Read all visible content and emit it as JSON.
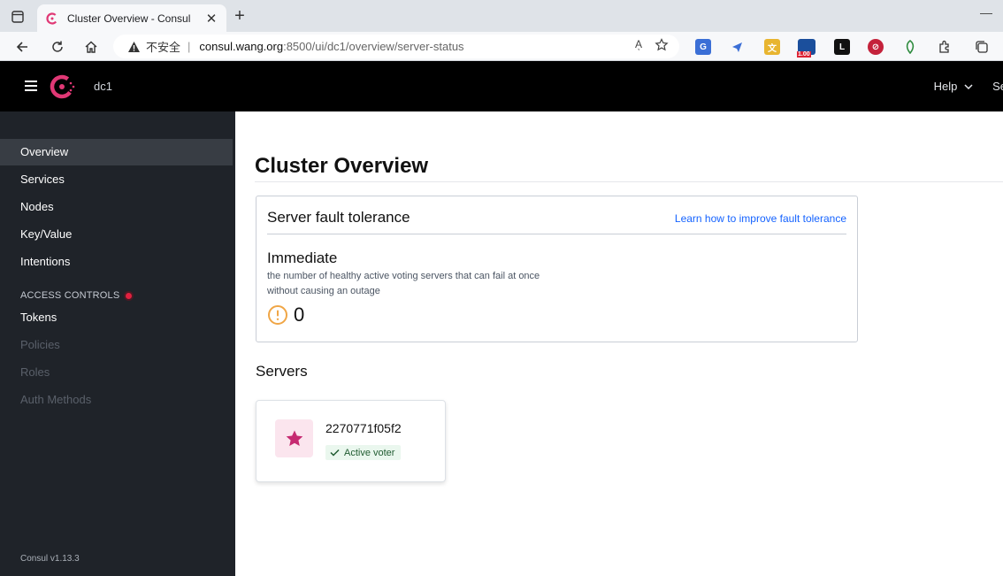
{
  "browser": {
    "tab_title": "Cluster Overview - Consul",
    "close_glyph": "✕",
    "new_tab_glyph": "+",
    "minimize_glyph": "—",
    "insecure_label": "不安全",
    "url_separator": "|",
    "url_host": "consul.wang.org",
    "url_path": ":8500/ui/dc1/overview/server-status",
    "read_aloud_label": "Aͅ",
    "badge_value": "1.00"
  },
  "header": {
    "datacenter": "dc1",
    "help_label": "Help",
    "settings_label": "Se"
  },
  "sidebar": {
    "items": [
      {
        "label": "Overview",
        "state": "active"
      },
      {
        "label": "Services",
        "state": "normal"
      },
      {
        "label": "Nodes",
        "state": "normal"
      },
      {
        "label": "Key/Value",
        "state": "normal"
      },
      {
        "label": "Intentions",
        "state": "normal"
      }
    ],
    "access_controls_heading": "ACCESS CONTROLS",
    "acl_items": [
      {
        "label": "Tokens",
        "state": "normal"
      },
      {
        "label": "Policies",
        "state": "disabled"
      },
      {
        "label": "Roles",
        "state": "disabled"
      },
      {
        "label": "Auth Methods",
        "state": "disabled"
      }
    ],
    "version": "Consul v1.13.3"
  },
  "main": {
    "title": "Cluster Overview",
    "fault_tolerance": {
      "title": "Server fault tolerance",
      "link": "Learn how to improve fault tolerance",
      "immediate_title": "Immediate",
      "immediate_desc": "the number of healthy active voting servers that can fail at once without causing an outage",
      "immediate_value": "0"
    },
    "servers_title": "Servers",
    "servers": [
      {
        "name": "2270771f05f2",
        "status": "Active voter"
      }
    ]
  },
  "colors": {
    "consul_brand": "#e03875",
    "link": "#1563ff",
    "warning": "#f0a646",
    "sidebar_bg": "#1f2329",
    "voter_bg": "#eaf7ee"
  }
}
